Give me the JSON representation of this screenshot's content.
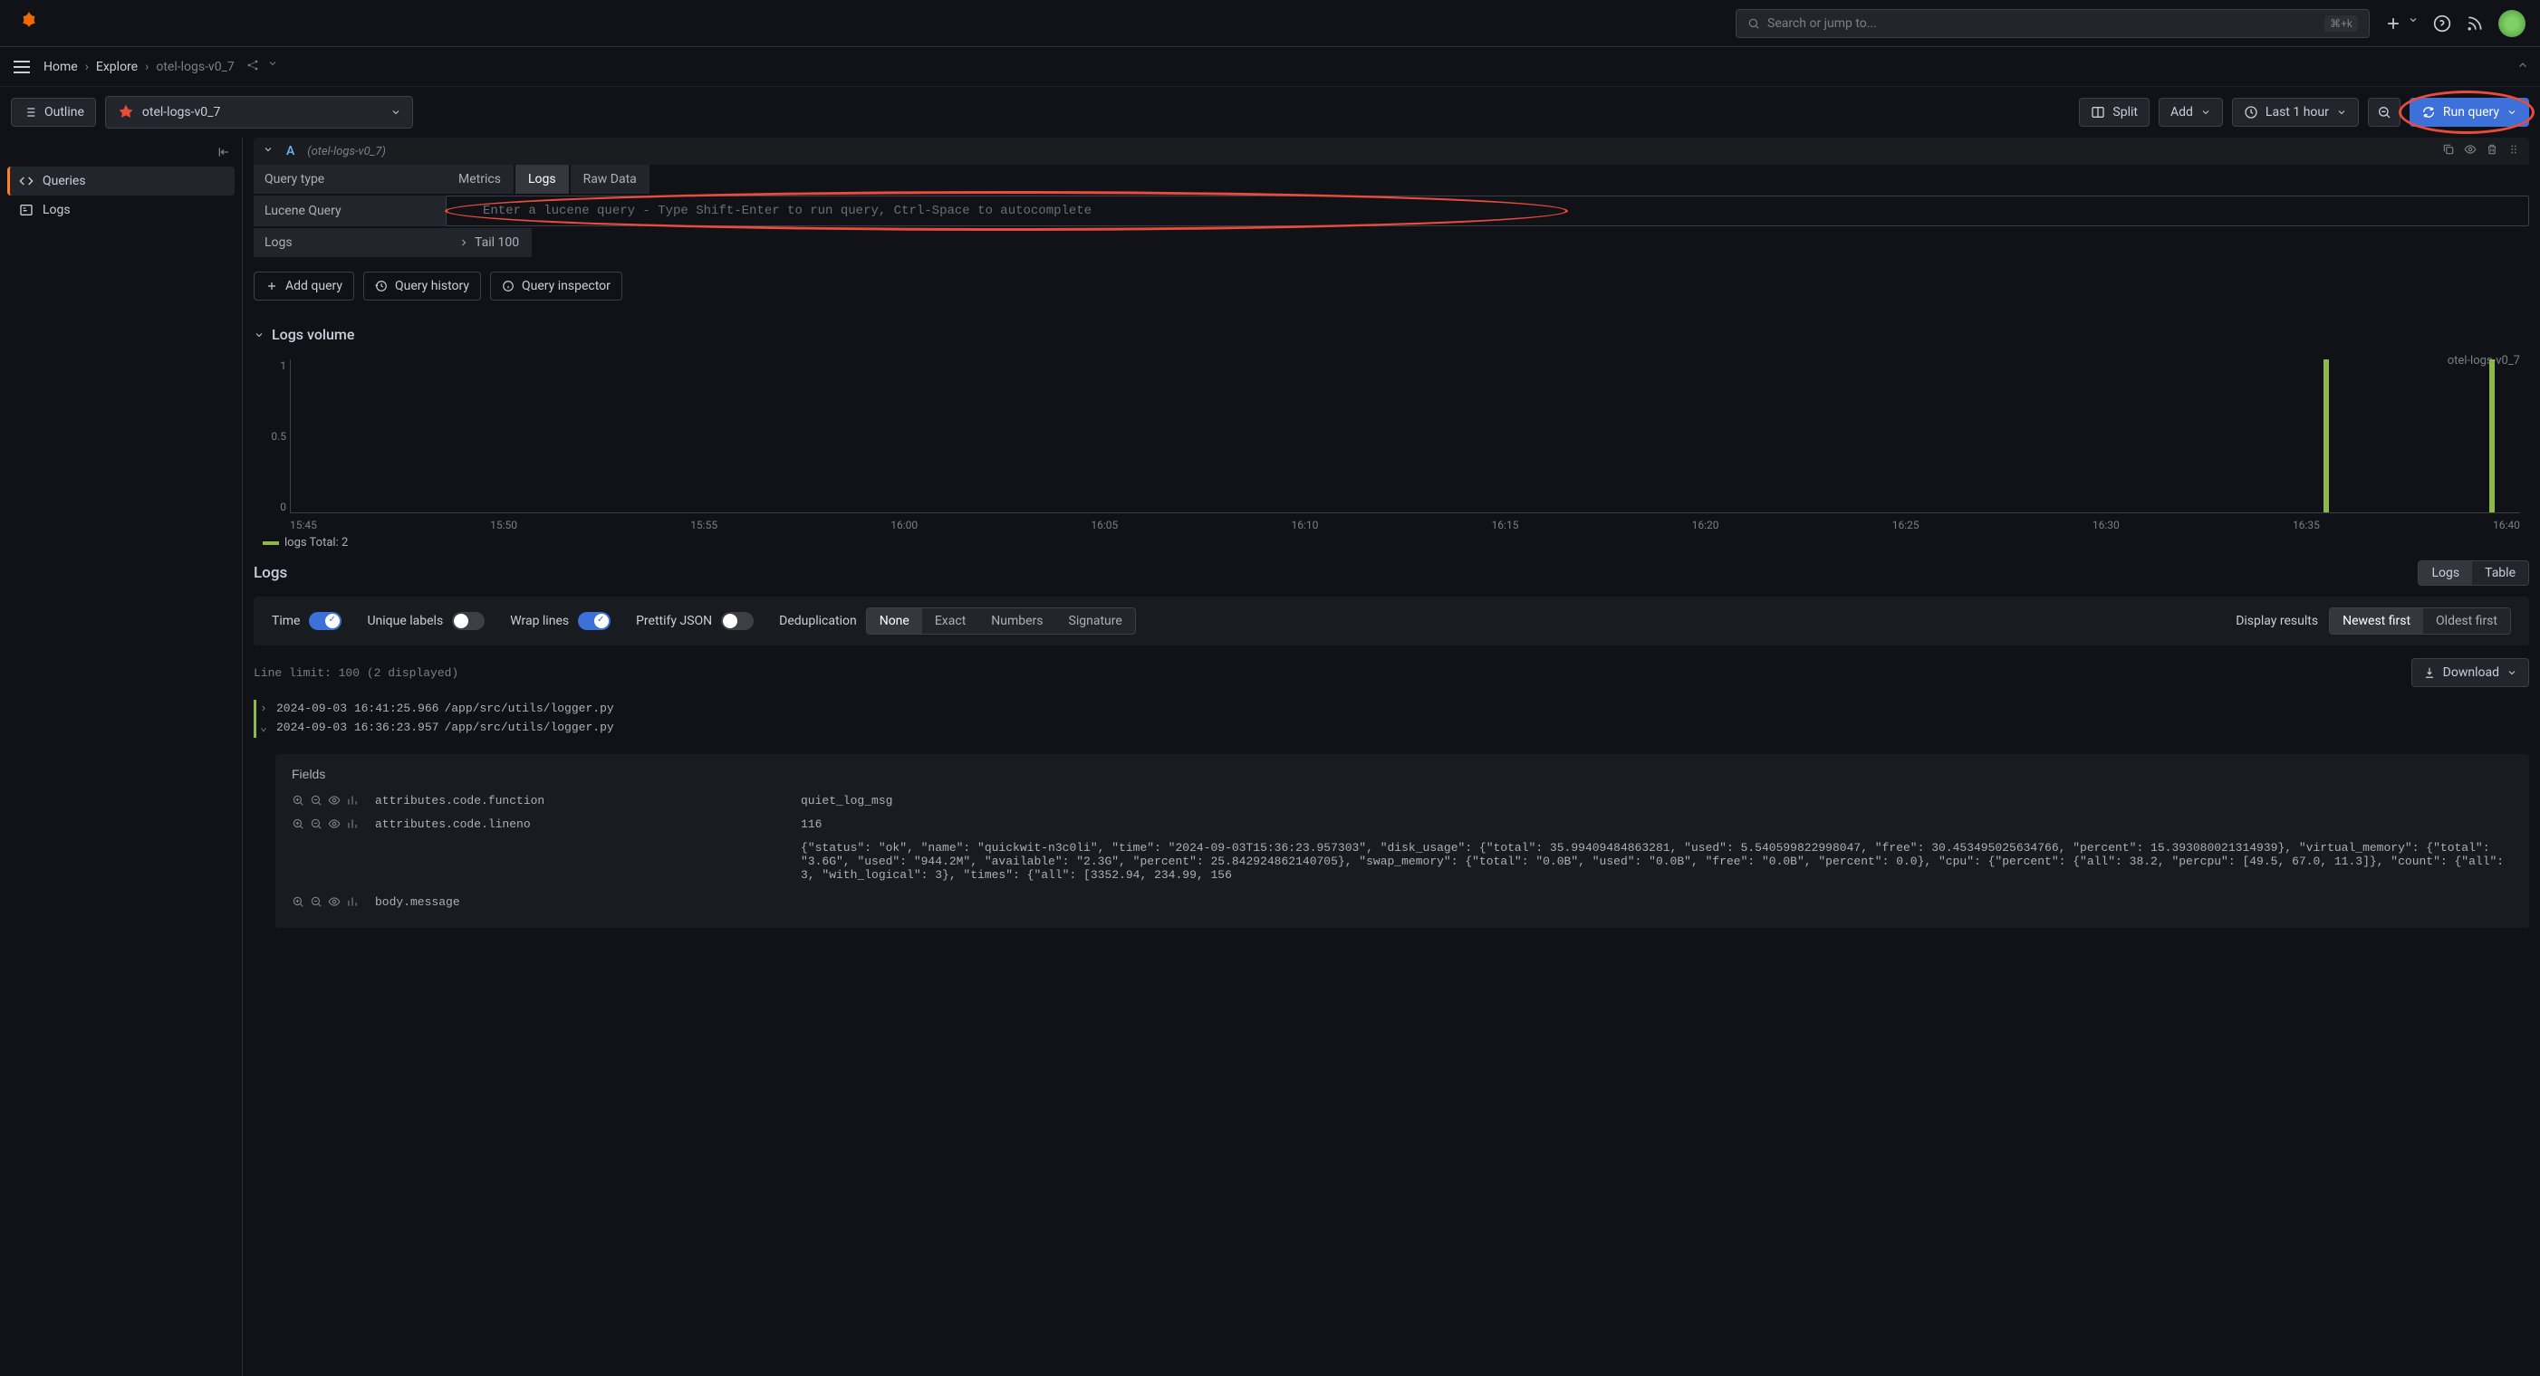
{
  "header": {
    "search_placeholder": "Search or jump to...",
    "kbd": "⌘+k"
  },
  "breadcrumb": {
    "home": "Home",
    "explore": "Explore",
    "current": "otel-logs-v0_7"
  },
  "toolbar": {
    "outline": "Outline",
    "datasource": "otel-logs-v0_7",
    "split": "Split",
    "add": "Add",
    "time_range": "Last 1 hour",
    "run_query": "Run query"
  },
  "sidebar": {
    "items": [
      {
        "label": "Queries",
        "active": true
      },
      {
        "label": "Logs",
        "active": false
      }
    ]
  },
  "query": {
    "letter": "A",
    "ds_name": "(otel-logs-v0_7)",
    "rows": {
      "query_type": {
        "label": "Query type",
        "options": [
          "Metrics",
          "Logs",
          "Raw Data"
        ],
        "selected": "Logs"
      },
      "lucene": {
        "label": "Lucene Query",
        "placeholder": "Enter a lucene query - Type Shift-Enter to run query, Ctrl-Space to autocomplete"
      },
      "logs": {
        "label": "Logs",
        "tail": "Tail 100"
      }
    },
    "actions": {
      "add_query": "Add query",
      "history": "Query history",
      "inspector": "Query inspector"
    }
  },
  "logs_volume": {
    "title": "Logs volume",
    "series_label": "otel-logs-v0_7",
    "legend": "logs  Total: 2"
  },
  "chart_data": {
    "type": "bar",
    "categories": [
      "15:45",
      "15:50",
      "15:55",
      "16:00",
      "16:05",
      "16:10",
      "16:15",
      "16:20",
      "16:25",
      "16:30",
      "16:35",
      "16:40"
    ],
    "x_labels": [
      "15:45",
      "15:50",
      "15:55",
      "16:00",
      "16:05",
      "16:10",
      "16:15",
      "16:20",
      "16:25",
      "16:30",
      "16:35",
      "16:40"
    ],
    "y_ticks": [
      1,
      0.5,
      0
    ],
    "series": [
      {
        "name": "logs",
        "color": "#8ab84a",
        "values": [
          0,
          0,
          0,
          0,
          0,
          0,
          0,
          0,
          0,
          0,
          1,
          1
        ]
      }
    ],
    "bar_positions_pct": [
      91.2,
      98.6
    ],
    "ylim": [
      0,
      1
    ],
    "title": "Logs volume"
  },
  "logs_panel": {
    "title": "Logs",
    "tabs": [
      "Logs",
      "Table"
    ],
    "active_tab": "Logs",
    "controls": {
      "time": {
        "label": "Time",
        "on": true
      },
      "unique_labels": {
        "label": "Unique labels",
        "on": false
      },
      "wrap_lines": {
        "label": "Wrap lines",
        "on": true
      },
      "prettify_json": {
        "label": "Prettify JSON",
        "on": false
      },
      "dedup": {
        "label": "Deduplication",
        "options": [
          "None",
          "Exact",
          "Numbers",
          "Signature"
        ],
        "selected": "None"
      },
      "display_results": {
        "label": "Display results",
        "options": [
          "Newest first",
          "Oldest first"
        ],
        "selected": "Newest first"
      }
    },
    "line_limit": "Line limit: 100 (2 displayed)",
    "download": "Download",
    "entries": [
      {
        "expanded": false,
        "ts": "2024-09-03 16:41:25.966",
        "msg": "/app/src/utils/logger.py"
      },
      {
        "expanded": true,
        "ts": "2024-09-03 16:36:23.957",
        "msg": "/app/src/utils/logger.py"
      }
    ],
    "fields": {
      "title": "Fields",
      "rows": [
        {
          "name": "attributes.code.function",
          "value": "quiet_log_msg"
        },
        {
          "name": "attributes.code.lineno",
          "value": "116"
        },
        {
          "name": "body.message",
          "value": "{\"status\": \"ok\", \"name\": \"quickwit-n3c0li\", \"time\": \"2024-09-03T15:36:23.957303\", \"disk_usage\": {\"total\": 35.99409484863281, \"used\": 5.540599822998047, \"free\": 30.453495025634766, \"percent\": 15.393080021314939}, \"virtual_memory\": {\"total\": \"3.6G\", \"used\": \"944.2M\", \"available\": \"2.3G\", \"percent\": 25.842924862140705}, \"swap_memory\": {\"total\": \"0.0B\", \"used\": \"0.0B\", \"free\": \"0.0B\", \"percent\": 0.0}, \"cpu\": {\"percent\": {\"all\": 38.2, \"percpu\": [49.5, 67.0, 11.3]}, \"count\": {\"all\": 3, \"with_logical\": 3}, \"times\": {\"all\": [3352.94, 234.99, 156"
        }
      ]
    }
  }
}
